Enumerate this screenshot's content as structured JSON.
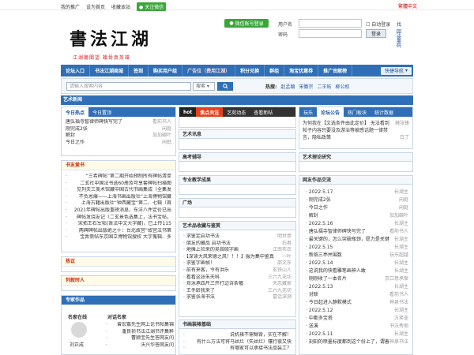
{
  "top": {
    "links": [
      "我的推广",
      "设为首页",
      "收藏本站"
    ],
    "wechat": "关注微信",
    "right": "繁體中文"
  },
  "brand": {
    "logo": "書法江湖",
    "slogan": "江湖聽聞望    鐵骨真英雄"
  },
  "subscribe": "微信账号登录",
  "login": {
    "user_label": "用户名",
    "pass_label": "密码",
    "autologin": "自动登录",
    "find_pwd": "找回密码",
    "login_btn": "登录",
    "register": "注册"
  },
  "nav": {
    "items": [
      "论坛入口",
      "书法江湖商城",
      "签到",
      "购买用户组",
      "广告位（费用江湖）",
      "积分兑换",
      "群组",
      "淘宝优惠券",
      "推广贡献榜"
    ],
    "quick": "快捷导航"
  },
  "search": {
    "placeholder": "请输入搜索内容",
    "select": "搜索",
    "hot_label": "热搜:",
    "hot": [
      "赵孟頫",
      "宋徽宗",
      "二王帖",
      "柳公权"
    ]
  },
  "section_title": "艺术新闻",
  "today": {
    "tabs": [
      "今日热点",
      "今日置顶"
    ],
    "rows": [
      {
        "t": "唐弘福寺智律师碑快写完了",
        "m": "看前书人"
      },
      {
        "t": "刚完成2张",
        "m": "闲庭"
      },
      {
        "t": "解封",
        "m": "加加碉叶"
      },
      {
        "t": "今日之作",
        "m": "闲庭"
      }
    ]
  },
  "recommend": {
    "title": "书友爱书",
    "rows": [
      "“三希碑帖”第二期开始预制所有碑帖清单",
      "二玄社中国法书选60册及可享套碑帖扫描图",
      "见列夫三美术馆藏中国古代书画集成（全集发",
      "不负恩爆——上海书画出版社“上海博物馆藏",
      "上海古籍出版社“钟西藏宝”第二、七辑（首",
      "2021年碑帖出版重磅消息，东洋八件定价已出",
      "碑帖发烧友记（二玄景色选集上，法书宝帖，",
      "宋拓王右军帖(晋法中文大字藏)，已上传115",
      "两碑碑帖出版绝之十：台北故宫“故宫法书第",
      "宝晋斋帖东京国立博物馆搜权 大字蒐辑、多"
    ]
  },
  "hot": {
    "title": "热议"
  },
  "recent": {
    "title": "列叙时人"
  },
  "experts": {
    "title": "专家作品",
    "name_label": "名家在线",
    "name": "刘正成",
    "dialog_title": "对话名家",
    "rows": [
      "曾宏翥先生网上论书帖集锦",
      "潘良祯书法江湖书评集粹",
      "曹颍宝先生答网友问",
      "沃兴华答网友问"
    ]
  },
  "center": {
    "tabs": [
      "hot",
      "焦点关注",
      "艺苑动态",
      "查看新帖"
    ],
    "blocks": [
      {
        "title": "艺术讯息"
      },
      {
        "title": "高考辅导"
      },
      {
        "title": "专业教学成果"
      },
      {
        "title": "广场"
      }
    ],
    "collect": {
      "title": "艺术品收藏与鉴赏",
      "rows": [
        {
          "t": "求鉴定启功书法",
          "m": "明世意"
        },
        {
          "t": "朋友的藏品 启功书法",
          "m": "石君"
        },
        {
          "t": "地摊上捡来的吴昌硕字画",
          "m": "江南布衣"
        },
        {
          "t": "【深读大风荣德之风！！！】服为集中鉴真",
          "m": "一叶"
        },
        {
          "t": "求鉴字画帧！",
          "m": "邵文东"
        },
        {
          "t": "前有来客，今有洪乐",
          "m": "玄铁山人"
        },
        {
          "t": "看看这张朱天科",
          "m": "三六九花坊"
        },
        {
          "t": "郑泳承四尺三开打边诗条幅",
          "m": "天恋藏家"
        },
        {
          "t": "王冬龄我来了",
          "m": "三六九花坊"
        },
        {
          "t": "求鉴张海书法",
          "m": "富话深溯"
        }
      ]
    },
    "basics": {
      "title": "书画装裱基础",
      "rows": [
        "说机裱不需糊背，实在不解！",
        "有什么方法可将马丝烂（失丝烂）镶行很又快",
        "有哪家可以承接书法品装工？"
      ]
    }
  },
  "right": {
    "tabs": [
      "玩乐",
      "论坛公告",
      "热门板块",
      "统计数据"
    ],
    "notice": "为何我在【文选条件由此定价】 无法看到帖子内容只要没及游治等被感话题一律禁言，隐私政策",
    "notice_by": "辣张锋",
    "notice_by2": "白丁",
    "theory": {
      "title": "艺术理论研究"
    },
    "talk": {
      "title": "网友作品交流",
      "rows": [
        {
          "t": "2022.5.17",
          "m": "长湖主"
        },
        {
          "t": "刚完成2张",
          "m": "闲庭"
        },
        {
          "t": "今日之作",
          "m": "闲庭"
        },
        {
          "t": "解封",
          "m": "加加碉叶"
        },
        {
          "t": "2022.5.16",
          "m": "长湖主"
        },
        {
          "t": "唐弘福寺智律师碑快写完了",
          "m": "看前书人"
        },
        {
          "t": "最关键的，怎么突破瓶颈，愿力是关键",
          "m": "长湖主"
        },
        {
          "t": "2022.5.15",
          "m": "长湖主"
        },
        {
          "t": "新临三亭并围数",
          "m": "玩乐超越"
        },
        {
          "t": "2022.5.14",
          "m": "长湖主"
        },
        {
          "t": "这说我的快看雕笔画神人敢",
          "m": "长湖主"
        },
        {
          "t": "刚刚收了一本名片",
          "m": "京口意承案"
        },
        {
          "t": "2022.5.13",
          "m": "长湖主"
        },
        {
          "t": "对联",
          "m": "看前书人"
        },
        {
          "t": "今日起进入静默模式",
          "m": "神泉书法"
        },
        {
          "t": "2022.5.12",
          "m": "长湖主"
        },
        {
          "t": "中都多宝塔",
          "m": "方笑壶"
        },
        {
          "t": "送溪",
          "m": "书法秀丽"
        },
        {
          "t": "2022.5.11",
          "m": "长湖主"
        },
        {
          "t": "刻刻的喷墨标度都到这个份上了，谓善",
          "m": "神泉书法"
        }
      ]
    }
  }
}
